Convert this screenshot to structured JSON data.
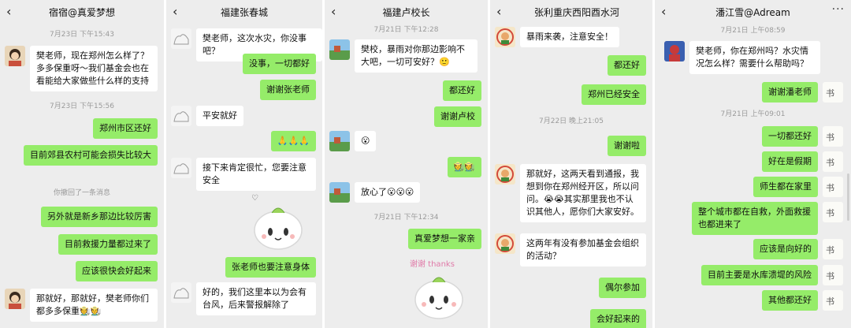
{
  "chats": [
    {
      "title": "宿宿@真爱梦想",
      "timestamps": [
        "7月23日 下午15:43",
        "7月23日 下午15:56"
      ],
      "system_notice": "你撤回了一条消息",
      "messages": [
        "樊老师，现在郑州怎么样了？多多保重呀～我们基金会也在看能给大家做些什么样的支持",
        "郑州市区还好",
        "目前郊县农村可能会损失比较大",
        "另外就是新乡那边比较厉害",
        "目前救援力量都过来了",
        "应该很快会好起来",
        "那就好，那就好，樊老师你们都多多保重🧑‍🌾🧑‍🌾"
      ]
    },
    {
      "title": "福建张春城",
      "messages": [
        "樊老师，这次水灾，你没事吧？",
        "没事，一切都好",
        "谢谢张老师",
        "平安就好",
        "🙏🙏🙏",
        "接下来肯定很忙，您要注意安全",
        "张老师也要注意身体",
        "好的，我们这里本以为会有台风，后来警报解除了"
      ]
    },
    {
      "title": "福建卢校长",
      "timestamps": [
        "7月21日 下午12:28",
        "7月21日 下午12:34"
      ],
      "messages": [
        "樊校，暴雨对你那边影响不大吧，一切可安好？🙂",
        "都还好",
        "谢谢卢校",
        "😮",
        "🧑‍🌾🧑‍🌾",
        "放心了😮😮😮",
        "真爱梦想一家亲"
      ],
      "sticker_text": "谢谢 thanks"
    },
    {
      "title": "张利重庆西阳酉水河",
      "timestamps": [
        "7月22日 晚上21:05"
      ],
      "messages": [
        "暴雨来袭，注意安全！",
        "都还好",
        "郑州已经安全",
        "谢谢啦",
        "那就好，这两天看到通报，我想到你在郑州经开区，所以问问。😭😭其实那里我也不认识其他人，愿你们大家安好。",
        "这两年有没有参加基金会组织的活动？",
        "偶尔参加",
        "会好起来的"
      ]
    },
    {
      "title": "潘江雪@Adream",
      "timestamps": [
        "7月21日 上午08:59",
        "7月21日 上午09:01"
      ],
      "messages": [
        "樊老师，你在郑州吗？水灾情况怎么样？需要什么帮助吗？",
        "谢谢潘老师",
        "一切都还好",
        "好在是假期",
        "师生都在家里",
        "整个城市都在自救，外面救援也都进来了",
        "应该是向好的",
        "目前主要是水库溃堤的风险",
        "其他都还好"
      ]
    }
  ],
  "colors": {
    "chat_bg": "#ededed",
    "bubble_in": "#ffffff",
    "bubble_out": "#95ec69",
    "timestamp": "#9a9a9a"
  },
  "icons": {
    "back": "‹",
    "more": "···"
  }
}
